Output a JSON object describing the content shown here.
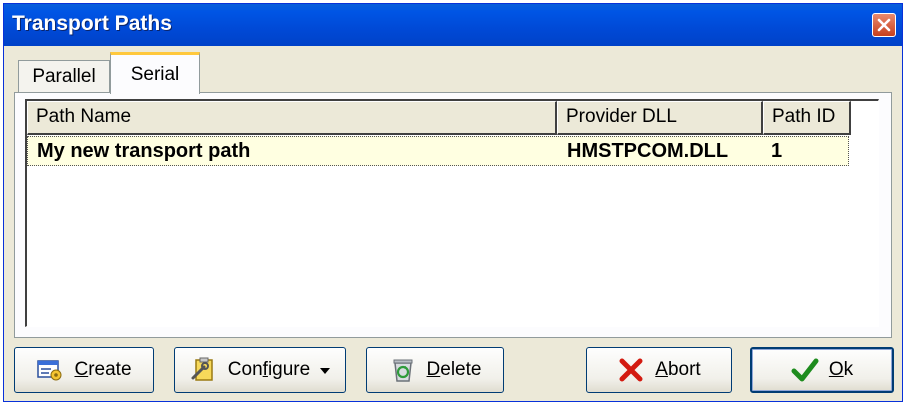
{
  "window": {
    "title": "Transport Paths"
  },
  "tabs": [
    {
      "label": "Parallel",
      "active": false
    },
    {
      "label": "Serial",
      "active": true
    }
  ],
  "list": {
    "columns": [
      "Path Name",
      "Provider DLL",
      "Path ID"
    ],
    "rows": [
      {
        "path_name": "My new transport path",
        "provider_dll": "HMSTPCOM.DLL",
        "path_id": "1"
      }
    ]
  },
  "buttons": {
    "create": {
      "mnemonic": "C",
      "rest": "reate",
      "icon": "create-icon"
    },
    "configure": {
      "pre": "Con",
      "mnemonic": "f",
      "rest": "igure",
      "icon": "configure-icon"
    },
    "delete": {
      "mnemonic": "D",
      "rest": "elete",
      "icon": "recycle-bin-icon"
    },
    "abort": {
      "mnemonic": "A",
      "rest": "bort",
      "icon": "red-x-icon"
    },
    "ok": {
      "mnemonic": "O",
      "rest": "k",
      "icon": "green-check-icon"
    }
  },
  "colors": {
    "titlebar": "#0055E5",
    "dialog_bg": "#ECE9D8",
    "selected_row": "#FFFFE1",
    "active_tab_highlight": "#FFC83C"
  }
}
